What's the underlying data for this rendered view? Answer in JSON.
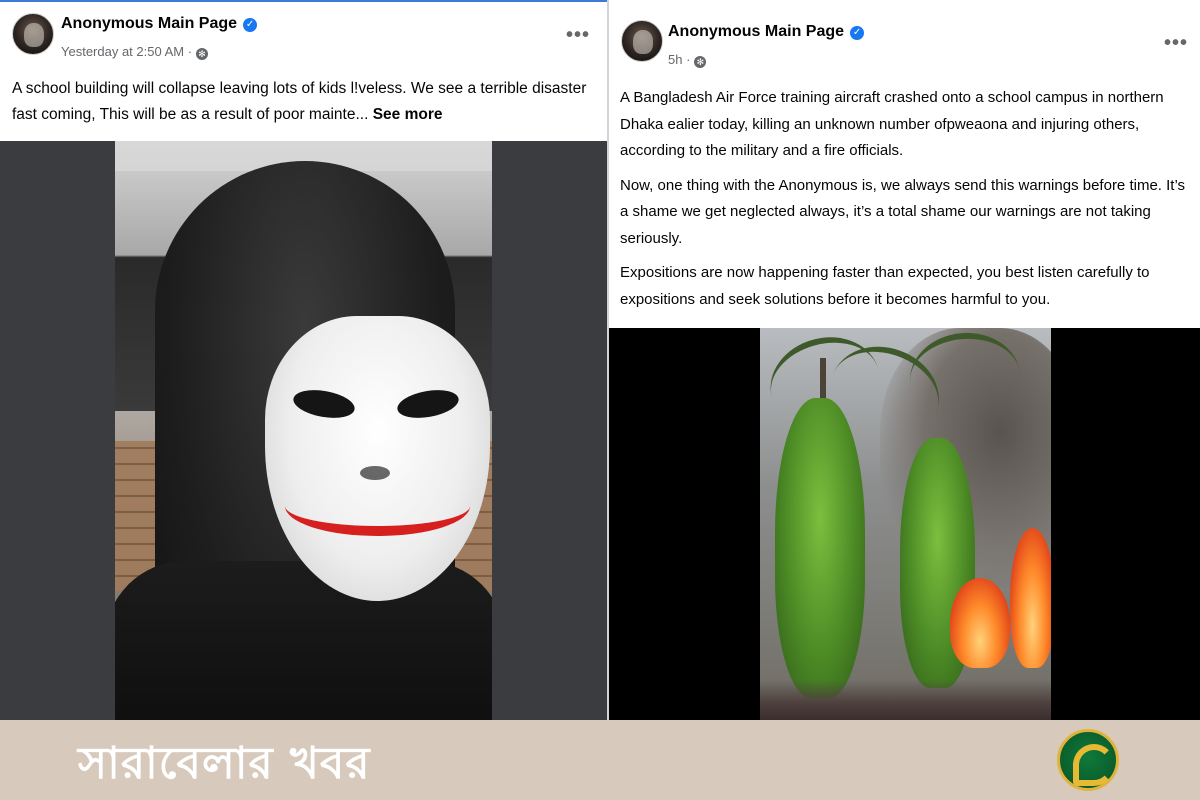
{
  "left_post": {
    "page_name": "Anonymous Main Page",
    "timestamp": "Yesterday at 2:50 AM",
    "menu_label": "•••",
    "text": "A school building will collapse leaving lots of kids l!veless. We see a terrible disaster fast coming, This will be as a result of poor mainte...",
    "see_more_label": "See more"
  },
  "right_post": {
    "page_name": "Anonymous Main Page",
    "timestamp": "5h",
    "menu_label": "•••",
    "paragraphs": [
      "A Bangladesh Air Force training aircraft crashed onto a school campus in northern Dhaka ealier today, killing an unknown number ofpweaona and injuring others, according to the military and a fire officials.",
      "Now, one thing with the Anonymous is, we always send this warnings before time. It’s a shame we get neglected always, it’s a total shame our warnings are not taking seriously.",
      "Expositions are now happening faster than expected, you best listen carefully to expositions and seek solutions before it becomes harmful to you."
    ]
  },
  "footer": {
    "brand_text": "সারাবেলার খবর"
  },
  "icons": {
    "verified": "verified-badge-icon",
    "globe": "settings-privacy-icon",
    "menu": "more-options-icon"
  },
  "colors": {
    "verified_blue": "#1877f2",
    "footer_bg": "#d7c9bc",
    "logo_green": "#0b5e2c",
    "logo_gold": "#e0b43a"
  }
}
